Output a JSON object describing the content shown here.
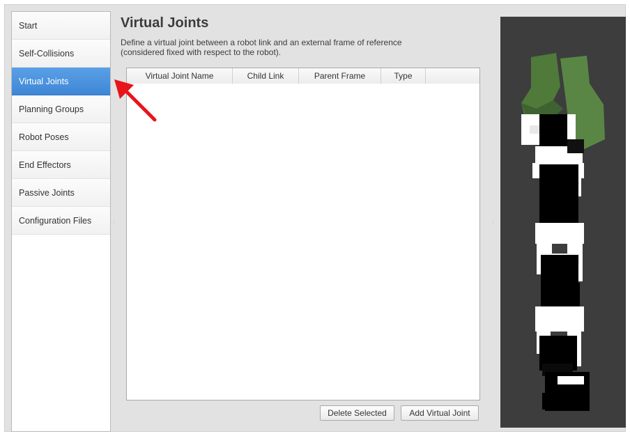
{
  "sidebar": {
    "items": [
      {
        "label": "Start"
      },
      {
        "label": "Self-Collisions"
      },
      {
        "label": "Virtual Joints"
      },
      {
        "label": "Planning Groups"
      },
      {
        "label": "Robot Poses"
      },
      {
        "label": "End Effectors"
      },
      {
        "label": "Passive Joints"
      },
      {
        "label": "Configuration Files"
      }
    ],
    "active_index": 2
  },
  "main": {
    "title": "Virtual Joints",
    "description_line1": "Define a virtual joint between a robot link and an external frame of reference",
    "description_line2": "(considered fixed with respect to the robot).",
    "table": {
      "columns": [
        "Virtual Joint Name",
        "Child Link",
        "Parent Frame",
        "Type"
      ],
      "rows": []
    },
    "buttons": {
      "delete_selected": "Delete Selected",
      "add_virtual_joint": "Add Virtual Joint"
    }
  },
  "colors": {
    "active_item": "#4a90e2",
    "viewer_background": "#3d3d3d",
    "annotation_arrow": "#e8141b",
    "robot_gripper": "#4f7a3a"
  },
  "icons": {
    "annotation": "red-arrow-icon",
    "splitter": "splitter-handle-icon"
  }
}
